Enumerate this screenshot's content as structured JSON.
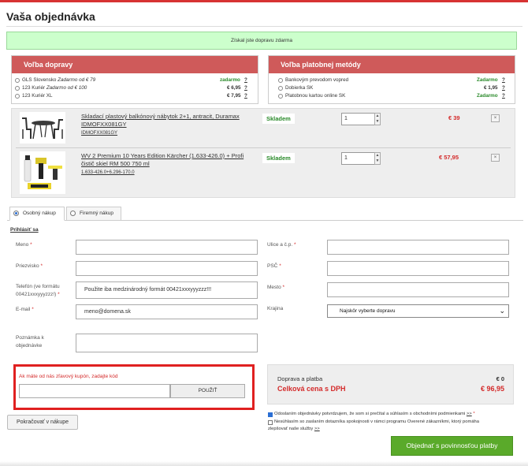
{
  "title": "Vaša objednávka",
  "notice": "Získal jste dopravu zdarma",
  "shipping": {
    "header": "Voľba dopravy",
    "options": [
      {
        "name": "GLS Slovensko",
        "note": "Zadarmo od € 79",
        "price": "zadarmo",
        "help": "?"
      },
      {
        "name": "123 Kuriér",
        "note": "Zadarmo od € 100",
        "price": "€ 6,95",
        "help": "?"
      },
      {
        "name": "123 Kuriér XL",
        "note": "",
        "price": "€ 7,95",
        "help": "?"
      }
    ]
  },
  "payment": {
    "header": "Voľba platobnej metódy",
    "options": [
      {
        "name": "Bankovým prevodom vopred",
        "price": "Zadarmo",
        "help": "?"
      },
      {
        "name": "Dobierka SK",
        "price": "€ 1,95",
        "help": "?"
      },
      {
        "name": "Platobnou kartou online SK",
        "price": "Zadarmo",
        "help": "?"
      }
    ]
  },
  "cart": {
    "items": [
      {
        "name_line1": "Skladací plastový balkónový nábytok 2+1, antracit, Duramax",
        "name_line2": "IDMOFXX081GY",
        "sku": "IDMOFXX081GY",
        "stock": "Skladem",
        "qty": "1",
        "price": "€ 39",
        "remove_icon": "×"
      },
      {
        "name_line1": "WV 2 Premium 10 Years Edition Kärcher (1.633-426.0) + Profi",
        "name_line2": "čistič skiel RM 500 750 ml",
        "sku": "1.633-426.0+6.296-170.0",
        "stock": "Skladem",
        "qty": "1",
        "price": "€ 57,95",
        "remove_icon": "×"
      }
    ]
  },
  "tabs": {
    "personal": "Osobný nákup",
    "company": "Firemný nákup"
  },
  "login_link": "Prihlásiť sa",
  "form": {
    "first_name": {
      "label": "Meno",
      "req": "*",
      "value": ""
    },
    "last_name": {
      "label": "Priezvisko",
      "req": "*",
      "value": ""
    },
    "phone": {
      "label_line1": "Telefón (ve formátu",
      "label_line2": "00421xxxyyyzzz!)",
      "req": "*",
      "value": "Použite iba medzinárodný formát 00421xxxyyyzzz!!!"
    },
    "email": {
      "label": "E-mail",
      "req": "*",
      "value": "meno@domena.sk"
    },
    "note": {
      "label_line1": "Poznámka k",
      "label_line2": "objednávke",
      "value": ""
    },
    "street": {
      "label": "Ulice a č.p.",
      "req": "*",
      "value": ""
    },
    "zip": {
      "label": "PSČ",
      "req": "*",
      "value": ""
    },
    "city": {
      "label": "Mesto",
      "req": "*",
      "value": ""
    },
    "country": {
      "label": "Krajina",
      "selected": "Najskôr vyberte dopravu"
    }
  },
  "coupon": {
    "label": "Ak máte od nás zľavový kupón, zadajte kód",
    "value": "",
    "button": "POUŽIŤ"
  },
  "summary": {
    "shipping_label": "Doprava a platba",
    "shipping_value": "€ 0",
    "total_label": "Celková cena s DPH",
    "total_value": "€ 96,95"
  },
  "consents": {
    "terms_text": "Odoslaním objednávky potvrdzujem, že som si prečítal a súhlasím s obchodními podmienkami",
    "terms_link": ">>",
    "terms_req": "*",
    "survey_line1": "Nesúhlasím so zaslaním dotazníka spokojnosti v rámci programu Overené zákazníkmi, ktorý pomáha",
    "survey_line2": "zlepšovať naše služby",
    "survey_link": ">>"
  },
  "buttons": {
    "continue": "Pokračovať v nákupe",
    "order": "Objednať s povinnosťou platby"
  },
  "colors": {
    "accent_red": "#cf5a5a",
    "price_red": "#d42a2a",
    "stock_green": "#2a8a2a",
    "order_green": "#5aaa2a",
    "notice_green": "#ccffcc"
  }
}
